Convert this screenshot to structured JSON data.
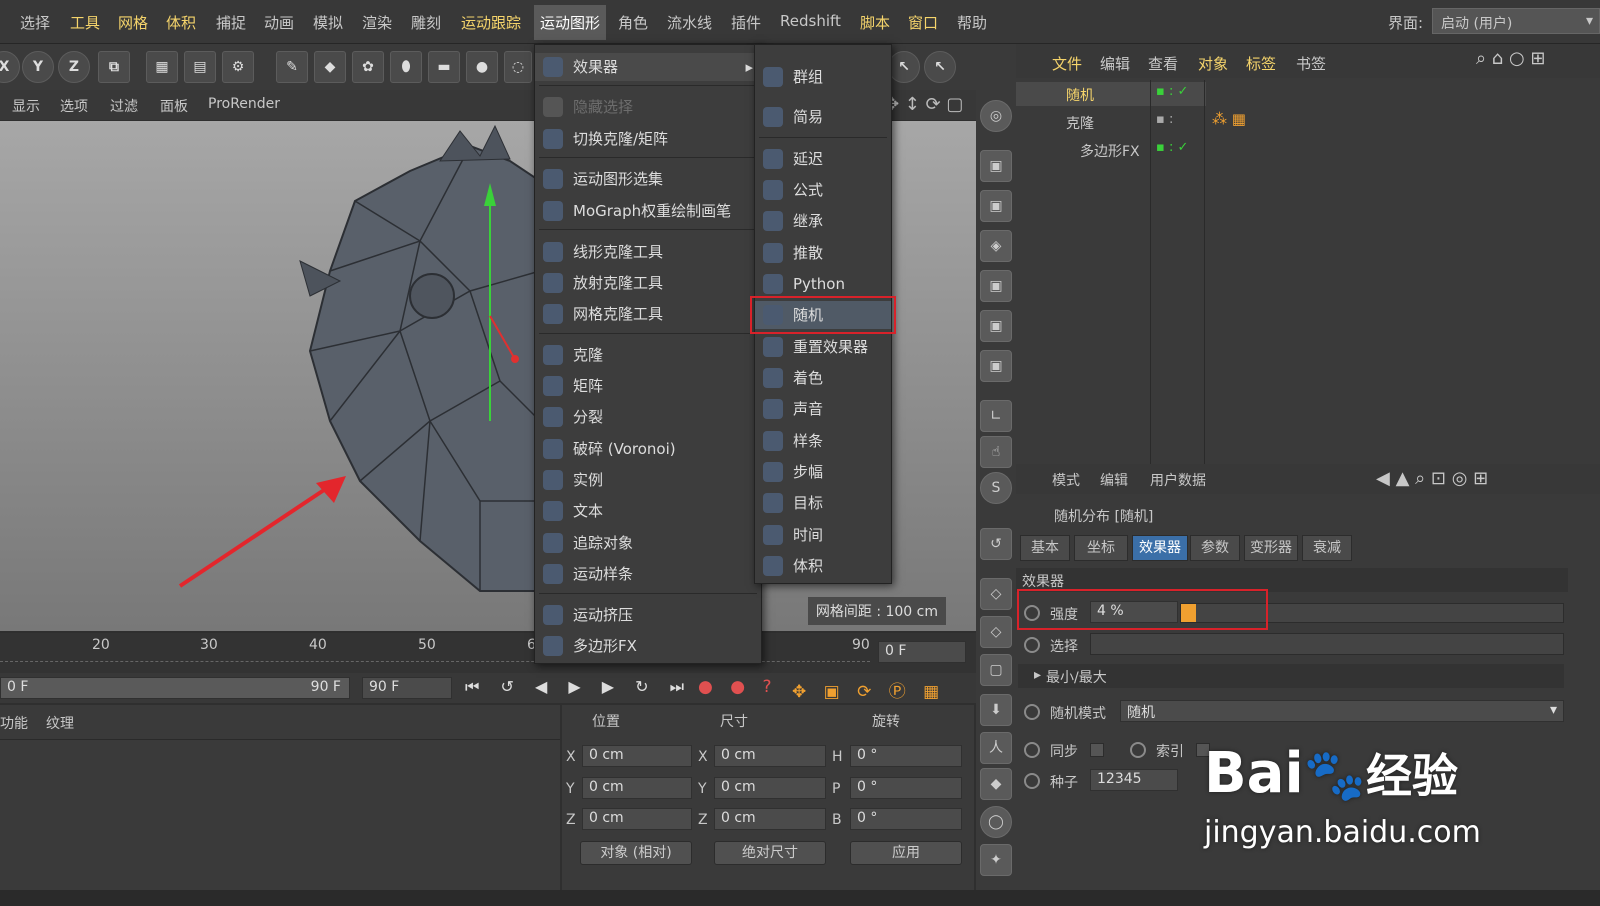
{
  "menubar": {
    "items": [
      "选择",
      "工具",
      "网格",
      "体积",
      "捕捉",
      "动画",
      "模拟",
      "渲染",
      "雕刻",
      "运动跟踪",
      "运动图形",
      "角色",
      "流水线",
      "插件",
      "Redshift",
      "脚本",
      "窗口",
      "帮助"
    ],
    "interface_label": "界面:",
    "interface_value": "启动 (用户)"
  },
  "toolbar": {
    "axes": [
      "X",
      "Y",
      "Z"
    ]
  },
  "viewport": {
    "menu": [
      "显示",
      "选项",
      "过滤",
      "面板",
      "ProRender"
    ],
    "grid_spacing": "网格间距 : 100 cm"
  },
  "mograph_menu": {
    "items": [
      {
        "label": "效果器",
        "icon": "effector-icon",
        "submenu": true
      },
      {
        "label": "隐藏选择",
        "icon": "hide-selection-icon",
        "disabled": true
      },
      {
        "label": "切换克隆/矩阵",
        "icon": "switch-clone-icon"
      },
      {
        "label": "运动图形选集",
        "icon": "mograph-selection-icon"
      },
      {
        "label": "MoGraph权重绘制画笔",
        "icon": "weight-brush-icon"
      },
      {
        "label": "线形克隆工具",
        "icon": "linear-clone-icon"
      },
      {
        "label": "放射克隆工具",
        "icon": "radial-clone-icon"
      },
      {
        "label": "网格克隆工具",
        "icon": "grid-clone-icon"
      },
      {
        "label": "克隆",
        "icon": "cloner-icon"
      },
      {
        "label": "矩阵",
        "icon": "matrix-icon"
      },
      {
        "label": "分裂",
        "icon": "fracture-icon"
      },
      {
        "label": "破碎 (Voronoi)",
        "icon": "voronoi-icon"
      },
      {
        "label": "实例",
        "icon": "instance-icon"
      },
      {
        "label": "文本",
        "icon": "text-icon"
      },
      {
        "label": "追踪对象",
        "icon": "tracer-icon"
      },
      {
        "label": "运动样条",
        "icon": "mospline-icon"
      },
      {
        "label": "运动挤压",
        "icon": "extrude-icon"
      },
      {
        "label": "多边形FX",
        "icon": "polyfx-icon"
      }
    ]
  },
  "effector_submenu": {
    "items": [
      {
        "label": "群组",
        "icon": "group-icon"
      },
      {
        "label": "简易",
        "icon": "plain-icon"
      },
      {
        "label": "延迟",
        "icon": "delay-icon"
      },
      {
        "label": "公式",
        "icon": "formula-icon"
      },
      {
        "label": "继承",
        "icon": "inheritance-icon"
      },
      {
        "label": "推散",
        "icon": "push-apart-icon"
      },
      {
        "label": "Python",
        "icon": "python-icon"
      },
      {
        "label": "随机",
        "icon": "random-icon",
        "highlighted": true
      },
      {
        "label": "重置效果器",
        "icon": "reeffector-icon"
      },
      {
        "label": "着色",
        "icon": "shader-icon"
      },
      {
        "label": "声音",
        "icon": "sound-icon"
      },
      {
        "label": "样条",
        "icon": "spline-icon"
      },
      {
        "label": "步幅",
        "icon": "step-icon"
      },
      {
        "label": "目标",
        "icon": "target-icon"
      },
      {
        "label": "时间",
        "icon": "time-icon"
      },
      {
        "label": "体积",
        "icon": "volume-icon"
      }
    ]
  },
  "timeline": {
    "ticks": [
      "20",
      "30",
      "40",
      "50",
      "6",
      "90"
    ],
    "current_frame": "0 F",
    "start_frame": "0 F",
    "end_field": "90 F",
    "end_frame": "90 F"
  },
  "bottom_tabs": [
    "功能",
    "纹理"
  ],
  "coordinates": {
    "headers": [
      "位置",
      "尺寸",
      "旋转"
    ],
    "rows": [
      {
        "a": "X",
        "pos": "0 cm",
        "b": "X",
        "size": "0 cm",
        "c": "H",
        "rot": "0 °"
      },
      {
        "a": "Y",
        "pos": "0 cm",
        "b": "Y",
        "size": "0 cm",
        "c": "P",
        "rot": "0 °"
      },
      {
        "a": "Z",
        "pos": "0 cm",
        "b": "Z",
        "size": "0 cm",
        "c": "B",
        "rot": "0 °"
      }
    ],
    "mode": "对象 (相对)",
    "size_mode": "绝对尺寸",
    "apply": "应用"
  },
  "object_manager": {
    "tabs": [
      "文件",
      "编辑",
      "查看",
      "对象",
      "标签",
      "书签"
    ],
    "objects": [
      "随机",
      "克隆",
      "多边形FX"
    ]
  },
  "attributes": {
    "tabs": [
      "模式",
      "编辑",
      "用户数据"
    ],
    "title": "随机分布 [随机]",
    "subtabs": [
      "基本",
      "坐标",
      "效果器",
      "参数",
      "变形器",
      "衰减"
    ],
    "section": "效果器",
    "strength_label": "强度",
    "strength_value": "4 %",
    "strength_fraction": 0.04,
    "select_label": "选择",
    "minmax_label": "最小/最大",
    "mode_label": "随机模式",
    "mode_value": "随机",
    "sync_label": "同步",
    "index_label": "索引",
    "seed_label": "种子",
    "seed_value": "12345"
  },
  "watermark": {
    "brand": "Bai",
    "brand2": "经验",
    "url": "jingyan.baidu.com"
  },
  "colors": {
    "accent": "#3b6fa8",
    "highlight": "#d8222a",
    "menu_hot": "#f5d46b"
  }
}
